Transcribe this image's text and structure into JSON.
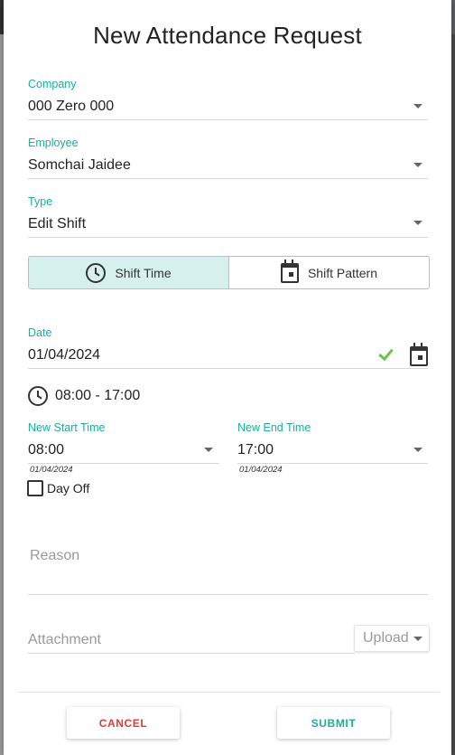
{
  "dialog": {
    "title": "New Attendance Request"
  },
  "company": {
    "label": "Company",
    "value": "000 Zero 000"
  },
  "employee": {
    "label": "Employee",
    "value": "Somchai Jaidee"
  },
  "type": {
    "label": "Type",
    "value": "Edit Shift"
  },
  "mode_toggle": {
    "options": [
      {
        "label": "Shift Time",
        "icon": "clock-icon",
        "selected": true
      },
      {
        "label": "Shift Pattern",
        "icon": "calendar-icon",
        "selected": false
      }
    ]
  },
  "date": {
    "label": "Date",
    "value": "01/04/2024",
    "valid_icon": "check-icon",
    "picker_icon": "calendar-icon"
  },
  "current_shift": {
    "icon": "clock-icon",
    "value": "08:00 - 17:00"
  },
  "new_start": {
    "label": "New Start Time",
    "value": "08:00",
    "sub_date": "01/04/2024"
  },
  "new_end": {
    "label": "New End Time",
    "value": "17:00",
    "sub_date": "01/04/2024"
  },
  "day_off": {
    "label": "Day Off",
    "checked": false
  },
  "reason": {
    "placeholder": "Reason"
  },
  "attachment": {
    "placeholder": "Attachment",
    "upload_label": "Upload"
  },
  "actions": {
    "cancel": "CANCEL",
    "submit": "SUBMIT"
  },
  "colors": {
    "accent": "#1fae9a",
    "cancel_text": "#e53935",
    "selected_toggle_bg": "#d6f1ed",
    "check": "#6cc24a"
  }
}
